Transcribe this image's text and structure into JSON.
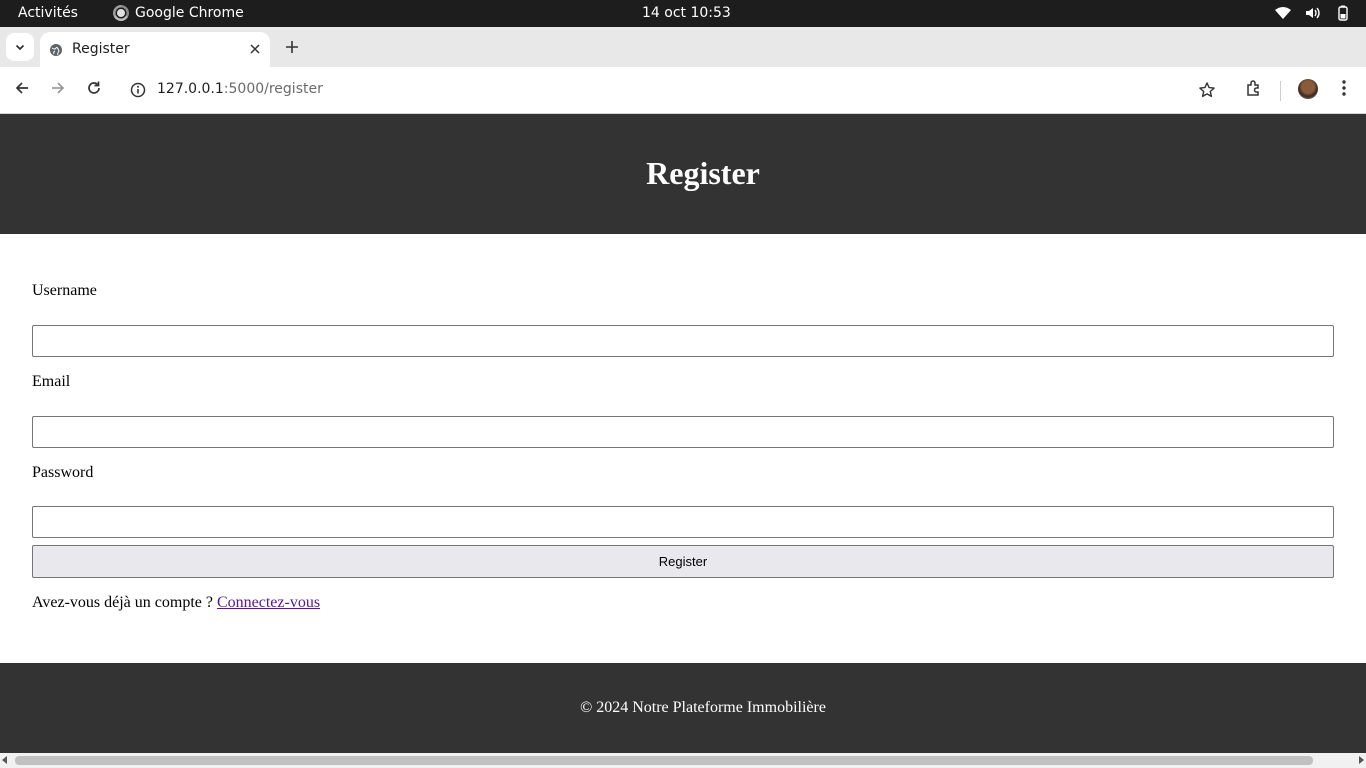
{
  "system_bar": {
    "activities": "Activités",
    "app_name": "Google Chrome",
    "clock": "14 oct  10:53",
    "icons": [
      "wifi-icon",
      "volume-icon",
      "battery-icon"
    ]
  },
  "browser": {
    "tab_title": "Register",
    "url_host": "127.0.0.1",
    "url_rest": ":5000/register",
    "icons": [
      "back-icon",
      "forward-icon",
      "reload-icon",
      "info-icon",
      "star-icon",
      "extensions-icon",
      "menu-icon"
    ]
  },
  "page": {
    "header_title": "Register",
    "fields": {
      "username_label": "Username",
      "username_value": "",
      "email_label": "Email",
      "email_value": "",
      "password_label": "Password",
      "password_value": ""
    },
    "submit_label": "Register",
    "login_prompt": "Avez-vous déjà un compte ?",
    "login_link": "Connectez-vous",
    "footer_text": "© 2024 Notre Plateforme Immobilière"
  },
  "colors": {
    "header_bg": "#333333",
    "footer_bg": "#333333",
    "link_visited": "#551a8b"
  }
}
